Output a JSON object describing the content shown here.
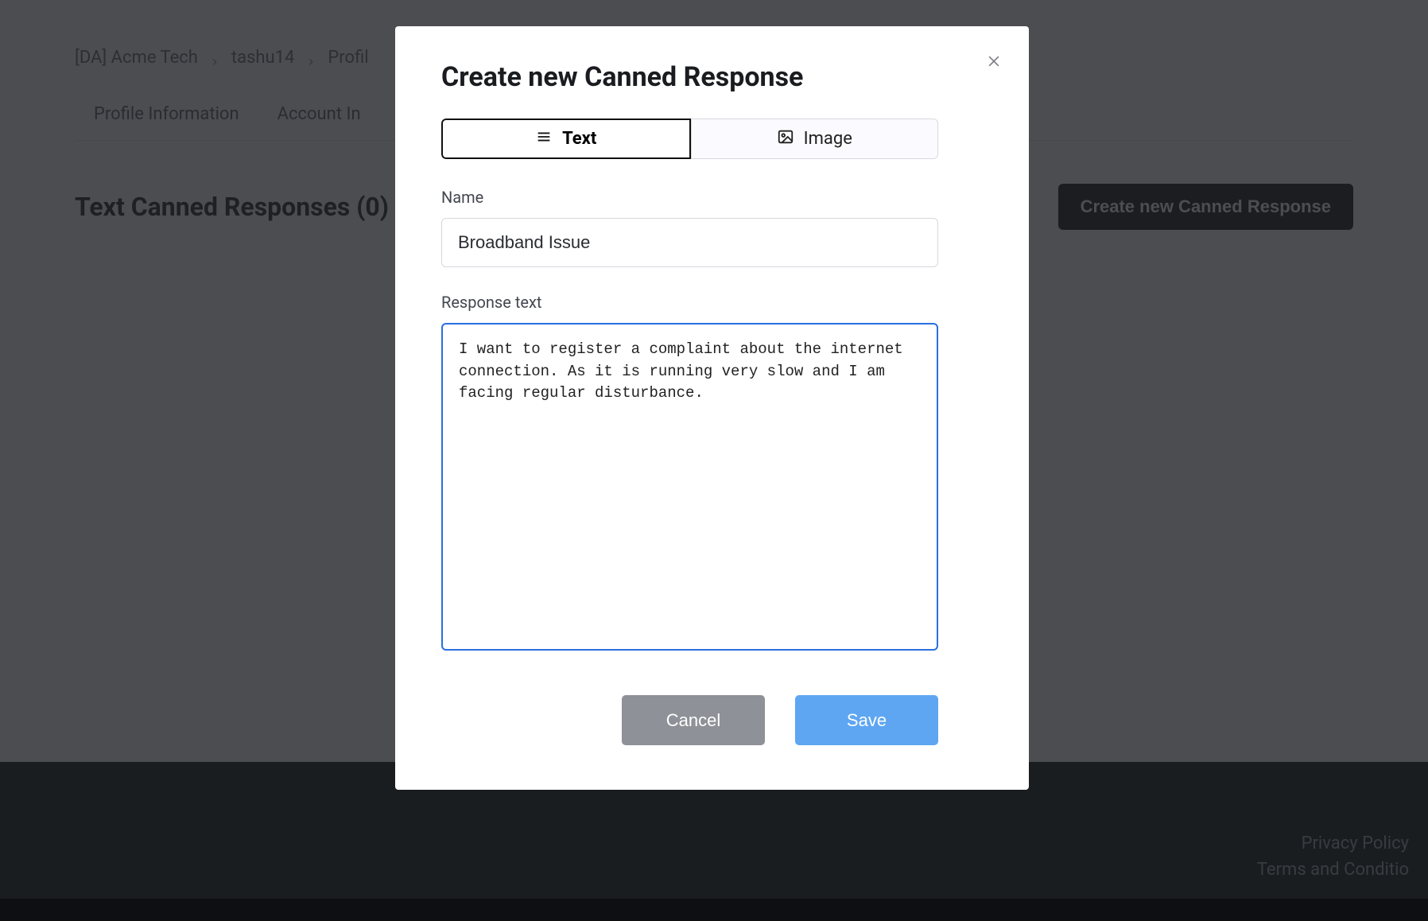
{
  "breadcrumb": {
    "item1": "[DA] Acme Tech",
    "item2": "tashu14",
    "item3": "Profil"
  },
  "tabs": {
    "profile_info": "Profile Information",
    "account_info_partial": "Account In"
  },
  "section": {
    "title": "Text Canned Responses (0)",
    "create_button": "Create new Canned Response"
  },
  "footer": {
    "privacy": "Privacy Policy",
    "terms": "Terms and Conditio"
  },
  "modal": {
    "title": "Create new Canned Response",
    "segment_text": "Text",
    "segment_image": "Image",
    "name_label": "Name",
    "name_value": "Broadband Issue",
    "response_label": "Response text",
    "response_value": "I want to register a complaint about the internet connection. As it is running very slow and I am facing regular disturbance.",
    "cancel": "Cancel",
    "save": "Save"
  }
}
